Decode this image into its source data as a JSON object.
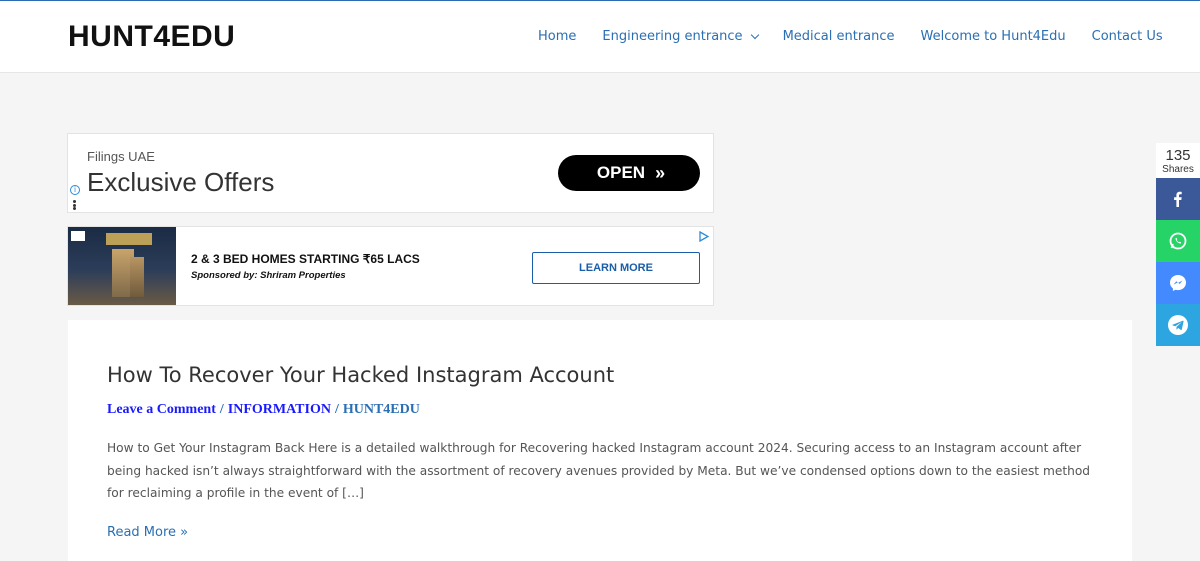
{
  "header": {
    "logo": "HUNT4EDU",
    "nav": [
      {
        "label": "Home"
      },
      {
        "label": "Engineering entrance"
      },
      {
        "label": "Medical entrance"
      },
      {
        "label": "Welcome to Hunt4Edu"
      },
      {
        "label": "Contact Us"
      }
    ]
  },
  "ad1": {
    "brand": "Filings UAE",
    "headline": "Exclusive Offers",
    "button": "OPEN",
    "button_arrows": "»"
  },
  "ad2": {
    "title": "2 & 3 BED HOMES STARTING ₹65 LACS",
    "sponsor": "Sponsored by: Shriram Properties",
    "button": "LEARN MORE"
  },
  "article": {
    "title": "How To Recover Your Hacked Instagram Account",
    "meta": {
      "comment": "Leave a Comment",
      "separator": "/",
      "category": "INFORMATION",
      "author": "HUNT4EDU"
    },
    "excerpt": "How to Get Your Instagram Back Here is a detailed walkthrough for Recovering hacked Instagram account 2024. Securing access to an Instagram account after being hacked isn’t always straightforward with the assortment of recovery avenues provided by Meta. But we’ve condensed options down to the easiest method for reclaiming a profile in the event of […]",
    "read_more": "Read More »"
  },
  "share": {
    "count": "135",
    "label": "Shares",
    "buttons": [
      "facebook-icon",
      "whatsapp-icon",
      "messenger-icon",
      "telegram-icon"
    ]
  },
  "colors": {
    "link": "#2a6fb3",
    "facebook": "#3b5998",
    "whatsapp": "#25d366",
    "messenger": "#448aff",
    "telegram": "#2ca5e0"
  }
}
